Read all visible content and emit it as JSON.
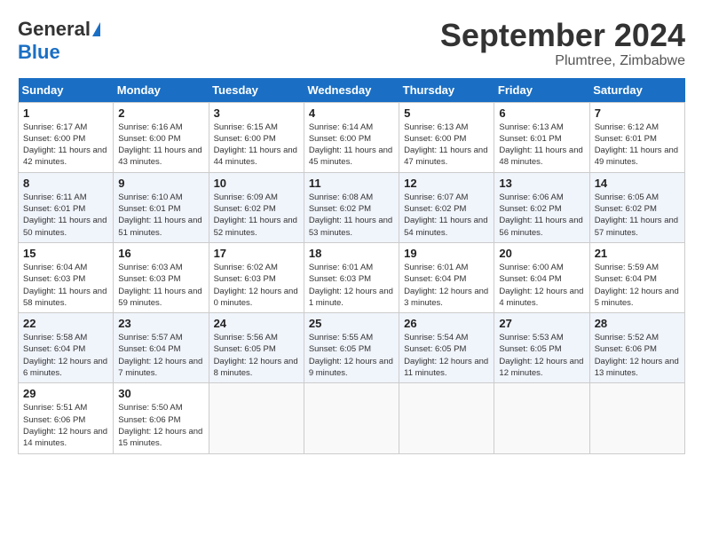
{
  "header": {
    "logo_general": "General",
    "logo_blue": "Blue",
    "month_title": "September 2024",
    "location": "Plumtree, Zimbabwe"
  },
  "days_of_week": [
    "Sunday",
    "Monday",
    "Tuesday",
    "Wednesday",
    "Thursday",
    "Friday",
    "Saturday"
  ],
  "weeks": [
    [
      {
        "day": "1",
        "sunrise": "Sunrise: 6:17 AM",
        "sunset": "Sunset: 6:00 PM",
        "daylight": "Daylight: 11 hours and 42 minutes."
      },
      {
        "day": "2",
        "sunrise": "Sunrise: 6:16 AM",
        "sunset": "Sunset: 6:00 PM",
        "daylight": "Daylight: 11 hours and 43 minutes."
      },
      {
        "day": "3",
        "sunrise": "Sunrise: 6:15 AM",
        "sunset": "Sunset: 6:00 PM",
        "daylight": "Daylight: 11 hours and 44 minutes."
      },
      {
        "day": "4",
        "sunrise": "Sunrise: 6:14 AM",
        "sunset": "Sunset: 6:00 PM",
        "daylight": "Daylight: 11 hours and 45 minutes."
      },
      {
        "day": "5",
        "sunrise": "Sunrise: 6:13 AM",
        "sunset": "Sunset: 6:00 PM",
        "daylight": "Daylight: 11 hours and 47 minutes."
      },
      {
        "day": "6",
        "sunrise": "Sunrise: 6:13 AM",
        "sunset": "Sunset: 6:01 PM",
        "daylight": "Daylight: 11 hours and 48 minutes."
      },
      {
        "day": "7",
        "sunrise": "Sunrise: 6:12 AM",
        "sunset": "Sunset: 6:01 PM",
        "daylight": "Daylight: 11 hours and 49 minutes."
      }
    ],
    [
      {
        "day": "8",
        "sunrise": "Sunrise: 6:11 AM",
        "sunset": "Sunset: 6:01 PM",
        "daylight": "Daylight: 11 hours and 50 minutes."
      },
      {
        "day": "9",
        "sunrise": "Sunrise: 6:10 AM",
        "sunset": "Sunset: 6:01 PM",
        "daylight": "Daylight: 11 hours and 51 minutes."
      },
      {
        "day": "10",
        "sunrise": "Sunrise: 6:09 AM",
        "sunset": "Sunset: 6:02 PM",
        "daylight": "Daylight: 11 hours and 52 minutes."
      },
      {
        "day": "11",
        "sunrise": "Sunrise: 6:08 AM",
        "sunset": "Sunset: 6:02 PM",
        "daylight": "Daylight: 11 hours and 53 minutes."
      },
      {
        "day": "12",
        "sunrise": "Sunrise: 6:07 AM",
        "sunset": "Sunset: 6:02 PM",
        "daylight": "Daylight: 11 hours and 54 minutes."
      },
      {
        "day": "13",
        "sunrise": "Sunrise: 6:06 AM",
        "sunset": "Sunset: 6:02 PM",
        "daylight": "Daylight: 11 hours and 56 minutes."
      },
      {
        "day": "14",
        "sunrise": "Sunrise: 6:05 AM",
        "sunset": "Sunset: 6:02 PM",
        "daylight": "Daylight: 11 hours and 57 minutes."
      }
    ],
    [
      {
        "day": "15",
        "sunrise": "Sunrise: 6:04 AM",
        "sunset": "Sunset: 6:03 PM",
        "daylight": "Daylight: 11 hours and 58 minutes."
      },
      {
        "day": "16",
        "sunrise": "Sunrise: 6:03 AM",
        "sunset": "Sunset: 6:03 PM",
        "daylight": "Daylight: 11 hours and 59 minutes."
      },
      {
        "day": "17",
        "sunrise": "Sunrise: 6:02 AM",
        "sunset": "Sunset: 6:03 PM",
        "daylight": "Daylight: 12 hours and 0 minutes."
      },
      {
        "day": "18",
        "sunrise": "Sunrise: 6:01 AM",
        "sunset": "Sunset: 6:03 PM",
        "daylight": "Daylight: 12 hours and 1 minute."
      },
      {
        "day": "19",
        "sunrise": "Sunrise: 6:01 AM",
        "sunset": "Sunset: 6:04 PM",
        "daylight": "Daylight: 12 hours and 3 minutes."
      },
      {
        "day": "20",
        "sunrise": "Sunrise: 6:00 AM",
        "sunset": "Sunset: 6:04 PM",
        "daylight": "Daylight: 12 hours and 4 minutes."
      },
      {
        "day": "21",
        "sunrise": "Sunrise: 5:59 AM",
        "sunset": "Sunset: 6:04 PM",
        "daylight": "Daylight: 12 hours and 5 minutes."
      }
    ],
    [
      {
        "day": "22",
        "sunrise": "Sunrise: 5:58 AM",
        "sunset": "Sunset: 6:04 PM",
        "daylight": "Daylight: 12 hours and 6 minutes."
      },
      {
        "day": "23",
        "sunrise": "Sunrise: 5:57 AM",
        "sunset": "Sunset: 6:04 PM",
        "daylight": "Daylight: 12 hours and 7 minutes."
      },
      {
        "day": "24",
        "sunrise": "Sunrise: 5:56 AM",
        "sunset": "Sunset: 6:05 PM",
        "daylight": "Daylight: 12 hours and 8 minutes."
      },
      {
        "day": "25",
        "sunrise": "Sunrise: 5:55 AM",
        "sunset": "Sunset: 6:05 PM",
        "daylight": "Daylight: 12 hours and 9 minutes."
      },
      {
        "day": "26",
        "sunrise": "Sunrise: 5:54 AM",
        "sunset": "Sunset: 6:05 PM",
        "daylight": "Daylight: 12 hours and 11 minutes."
      },
      {
        "day": "27",
        "sunrise": "Sunrise: 5:53 AM",
        "sunset": "Sunset: 6:05 PM",
        "daylight": "Daylight: 12 hours and 12 minutes."
      },
      {
        "day": "28",
        "sunrise": "Sunrise: 5:52 AM",
        "sunset": "Sunset: 6:06 PM",
        "daylight": "Daylight: 12 hours and 13 minutes."
      }
    ],
    [
      {
        "day": "29",
        "sunrise": "Sunrise: 5:51 AM",
        "sunset": "Sunset: 6:06 PM",
        "daylight": "Daylight: 12 hours and 14 minutes."
      },
      {
        "day": "30",
        "sunrise": "Sunrise: 5:50 AM",
        "sunset": "Sunset: 6:06 PM",
        "daylight": "Daylight: 12 hours and 15 minutes."
      },
      null,
      null,
      null,
      null,
      null
    ]
  ]
}
